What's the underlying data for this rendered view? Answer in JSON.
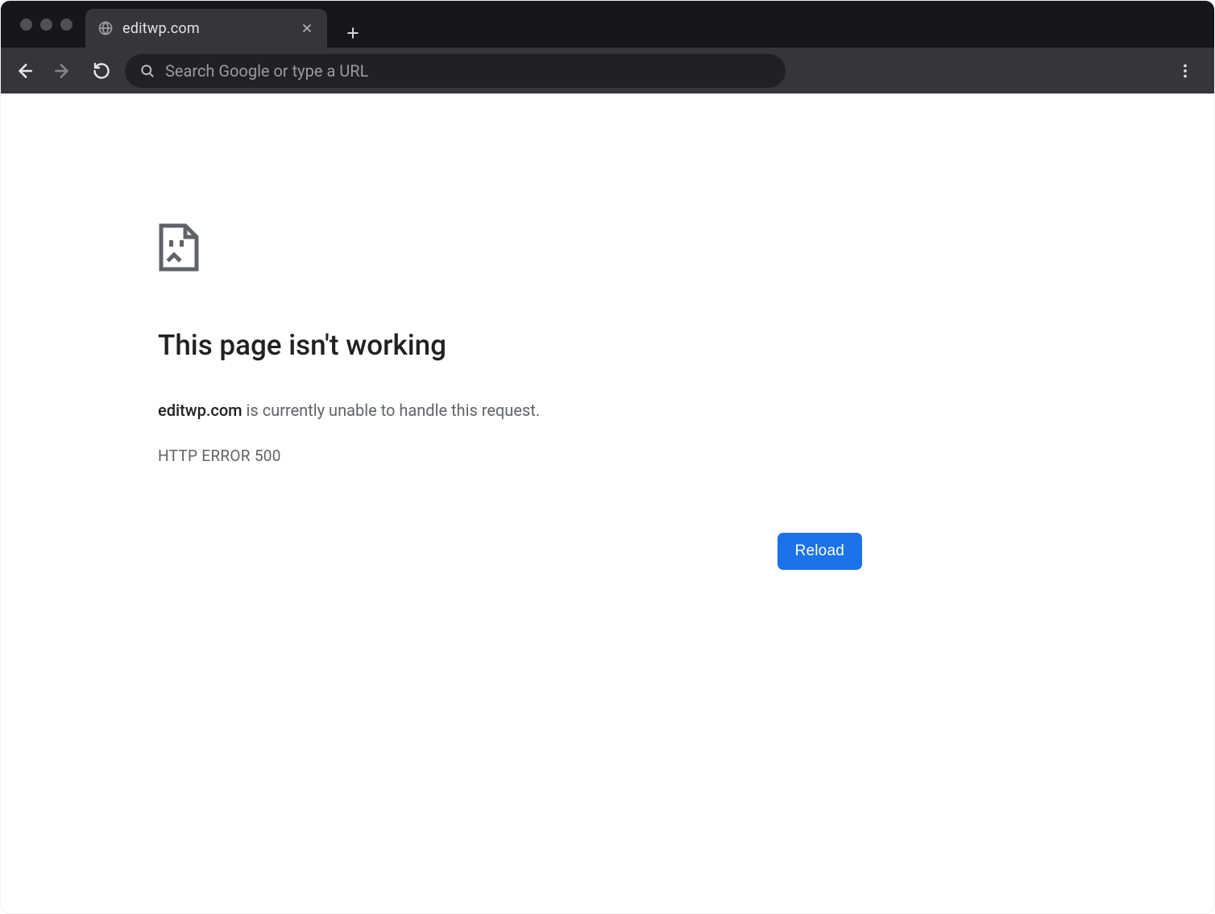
{
  "window": {
    "tab": {
      "title": "editwp.com"
    }
  },
  "toolbar": {
    "search_placeholder": "Search Google or type a URL"
  },
  "error": {
    "heading": "This page isn't working",
    "domain": "editwp.com",
    "message_suffix": " is currently unable to handle this request.",
    "code": "HTTP ERROR 500",
    "reload_label": "Reload"
  },
  "colors": {
    "accent": "#1a73e8",
    "bg_dark": "#16171a",
    "bg_dark2": "#35363a",
    "bg_omnibox": "#202124"
  }
}
